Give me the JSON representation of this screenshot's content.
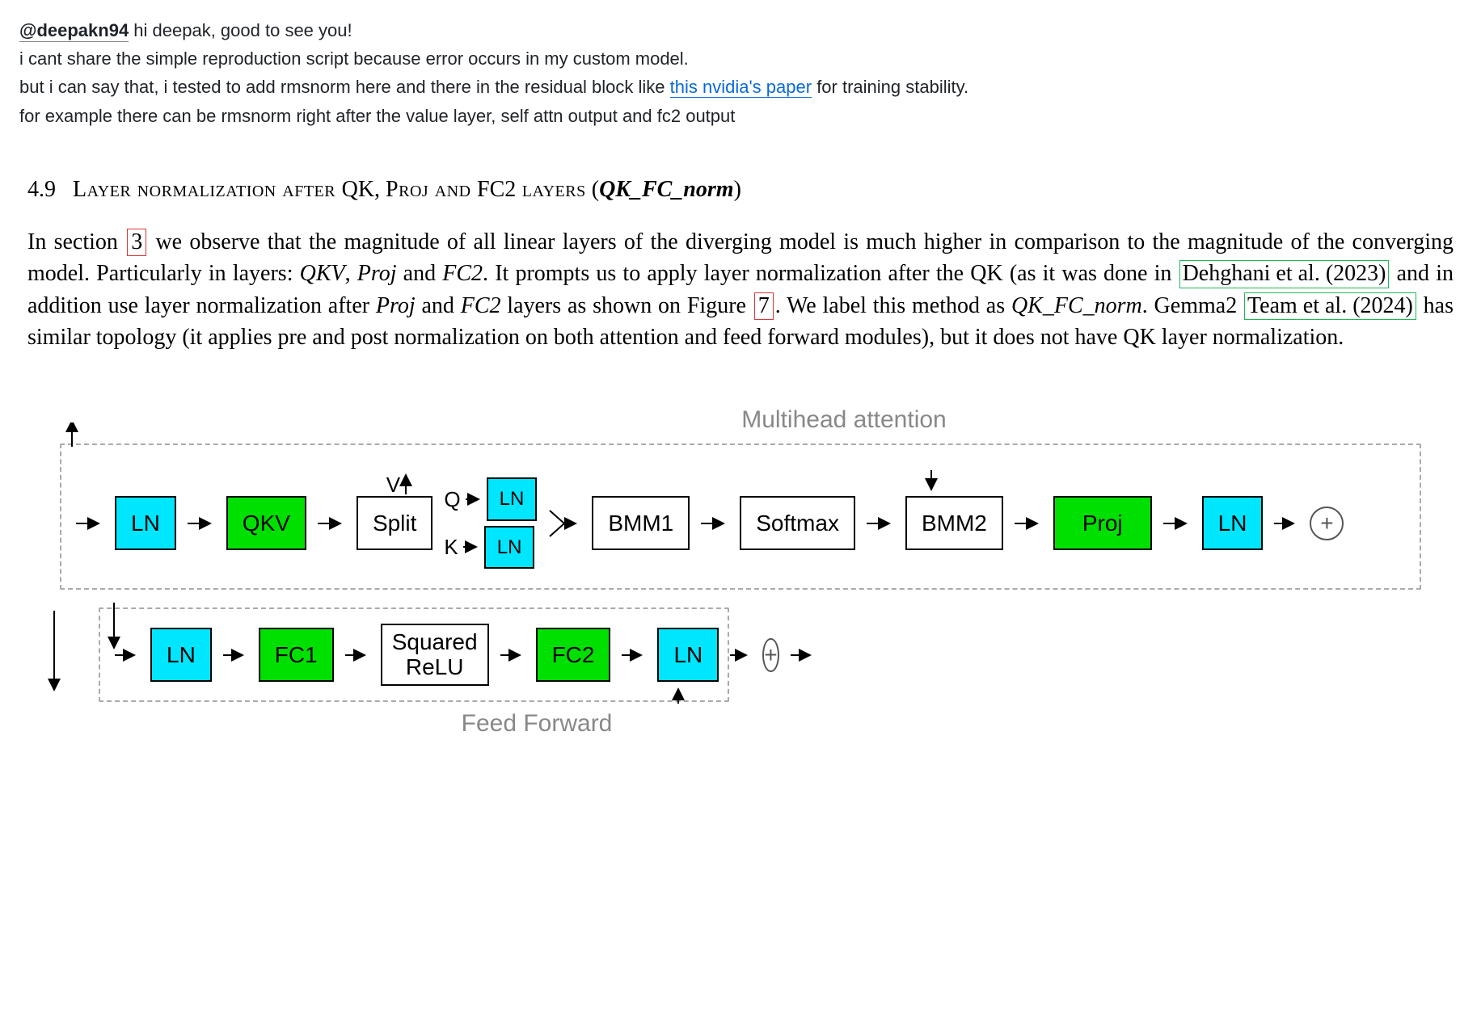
{
  "comment": {
    "mention": "@deepakn94",
    "line1_after_mention": " hi deepak, good to see you!",
    "line2": "i cant share the simple reproduction script because error occurs in my custom model.",
    "line3_before_link": "but i can say that, i tested to add rmsnorm here and there in the residual block like ",
    "link_text": "this nvidia's paper",
    "line3_after_link": " for training stability.",
    "line4": "for example there can be rmsnorm right after the value layer, self attn output and fc2 output"
  },
  "paper": {
    "section_number": "4.9",
    "heading_sc_1": "Layer normalization after ",
    "heading_qk": "QK, ",
    "heading_sc_2": "Proj",
    "heading_sc_3": " and ",
    "heading_fc2": "FC2",
    "heading_sc_4": " layers",
    "heading_paren_open": " (",
    "heading_term": "QK_FC_norm",
    "heading_paren_close": ")",
    "body": {
      "t1": "In section ",
      "ref3": "3",
      "t2": " we observe that the magnitude of all linear layers of the diverging model is much higher in comparison to the magnitude of the converging model. Particularly in layers: ",
      "i_qkv": "QKV",
      "t3": ", ",
      "i_proj": "Proj",
      "t4": " and ",
      "i_fc2": "FC2",
      "t5": ". It prompts us to apply layer normalization after the QK (as it was done in ",
      "ref_dehghani": "Dehghani et al. (2023)",
      "t6": " and in addition use layer normalization after ",
      "i_proj2": "Proj",
      "t7": " and ",
      "i_fc22": "FC2",
      "t8": " layers as shown on Figure ",
      "ref7": "7",
      "t9": ". We label this method as ",
      "i_term": "QK_FC_norm",
      "t10": ". Gemma2 ",
      "ref_team": "Team et al. (2024)",
      "t11": " has similar topology (it applies pre and post normalization on both attention and feed forward modules), but it does not have QK layer normalization."
    }
  },
  "diagram": {
    "label_attn": "Multihead attention",
    "label_ff": "Feed Forward",
    "blocks": {
      "ln": "LN",
      "qkv": "QKV",
      "split": "Split",
      "bmm1": "BMM1",
      "softmax": "Softmax",
      "bmm2": "BMM2",
      "proj": "Proj",
      "fc1": "FC1",
      "srelu_l1": "Squared",
      "srelu_l2": "ReLU",
      "fc2": "FC2",
      "plus": "+"
    },
    "letters": {
      "v": "V",
      "q": "Q",
      "k": "K"
    }
  }
}
